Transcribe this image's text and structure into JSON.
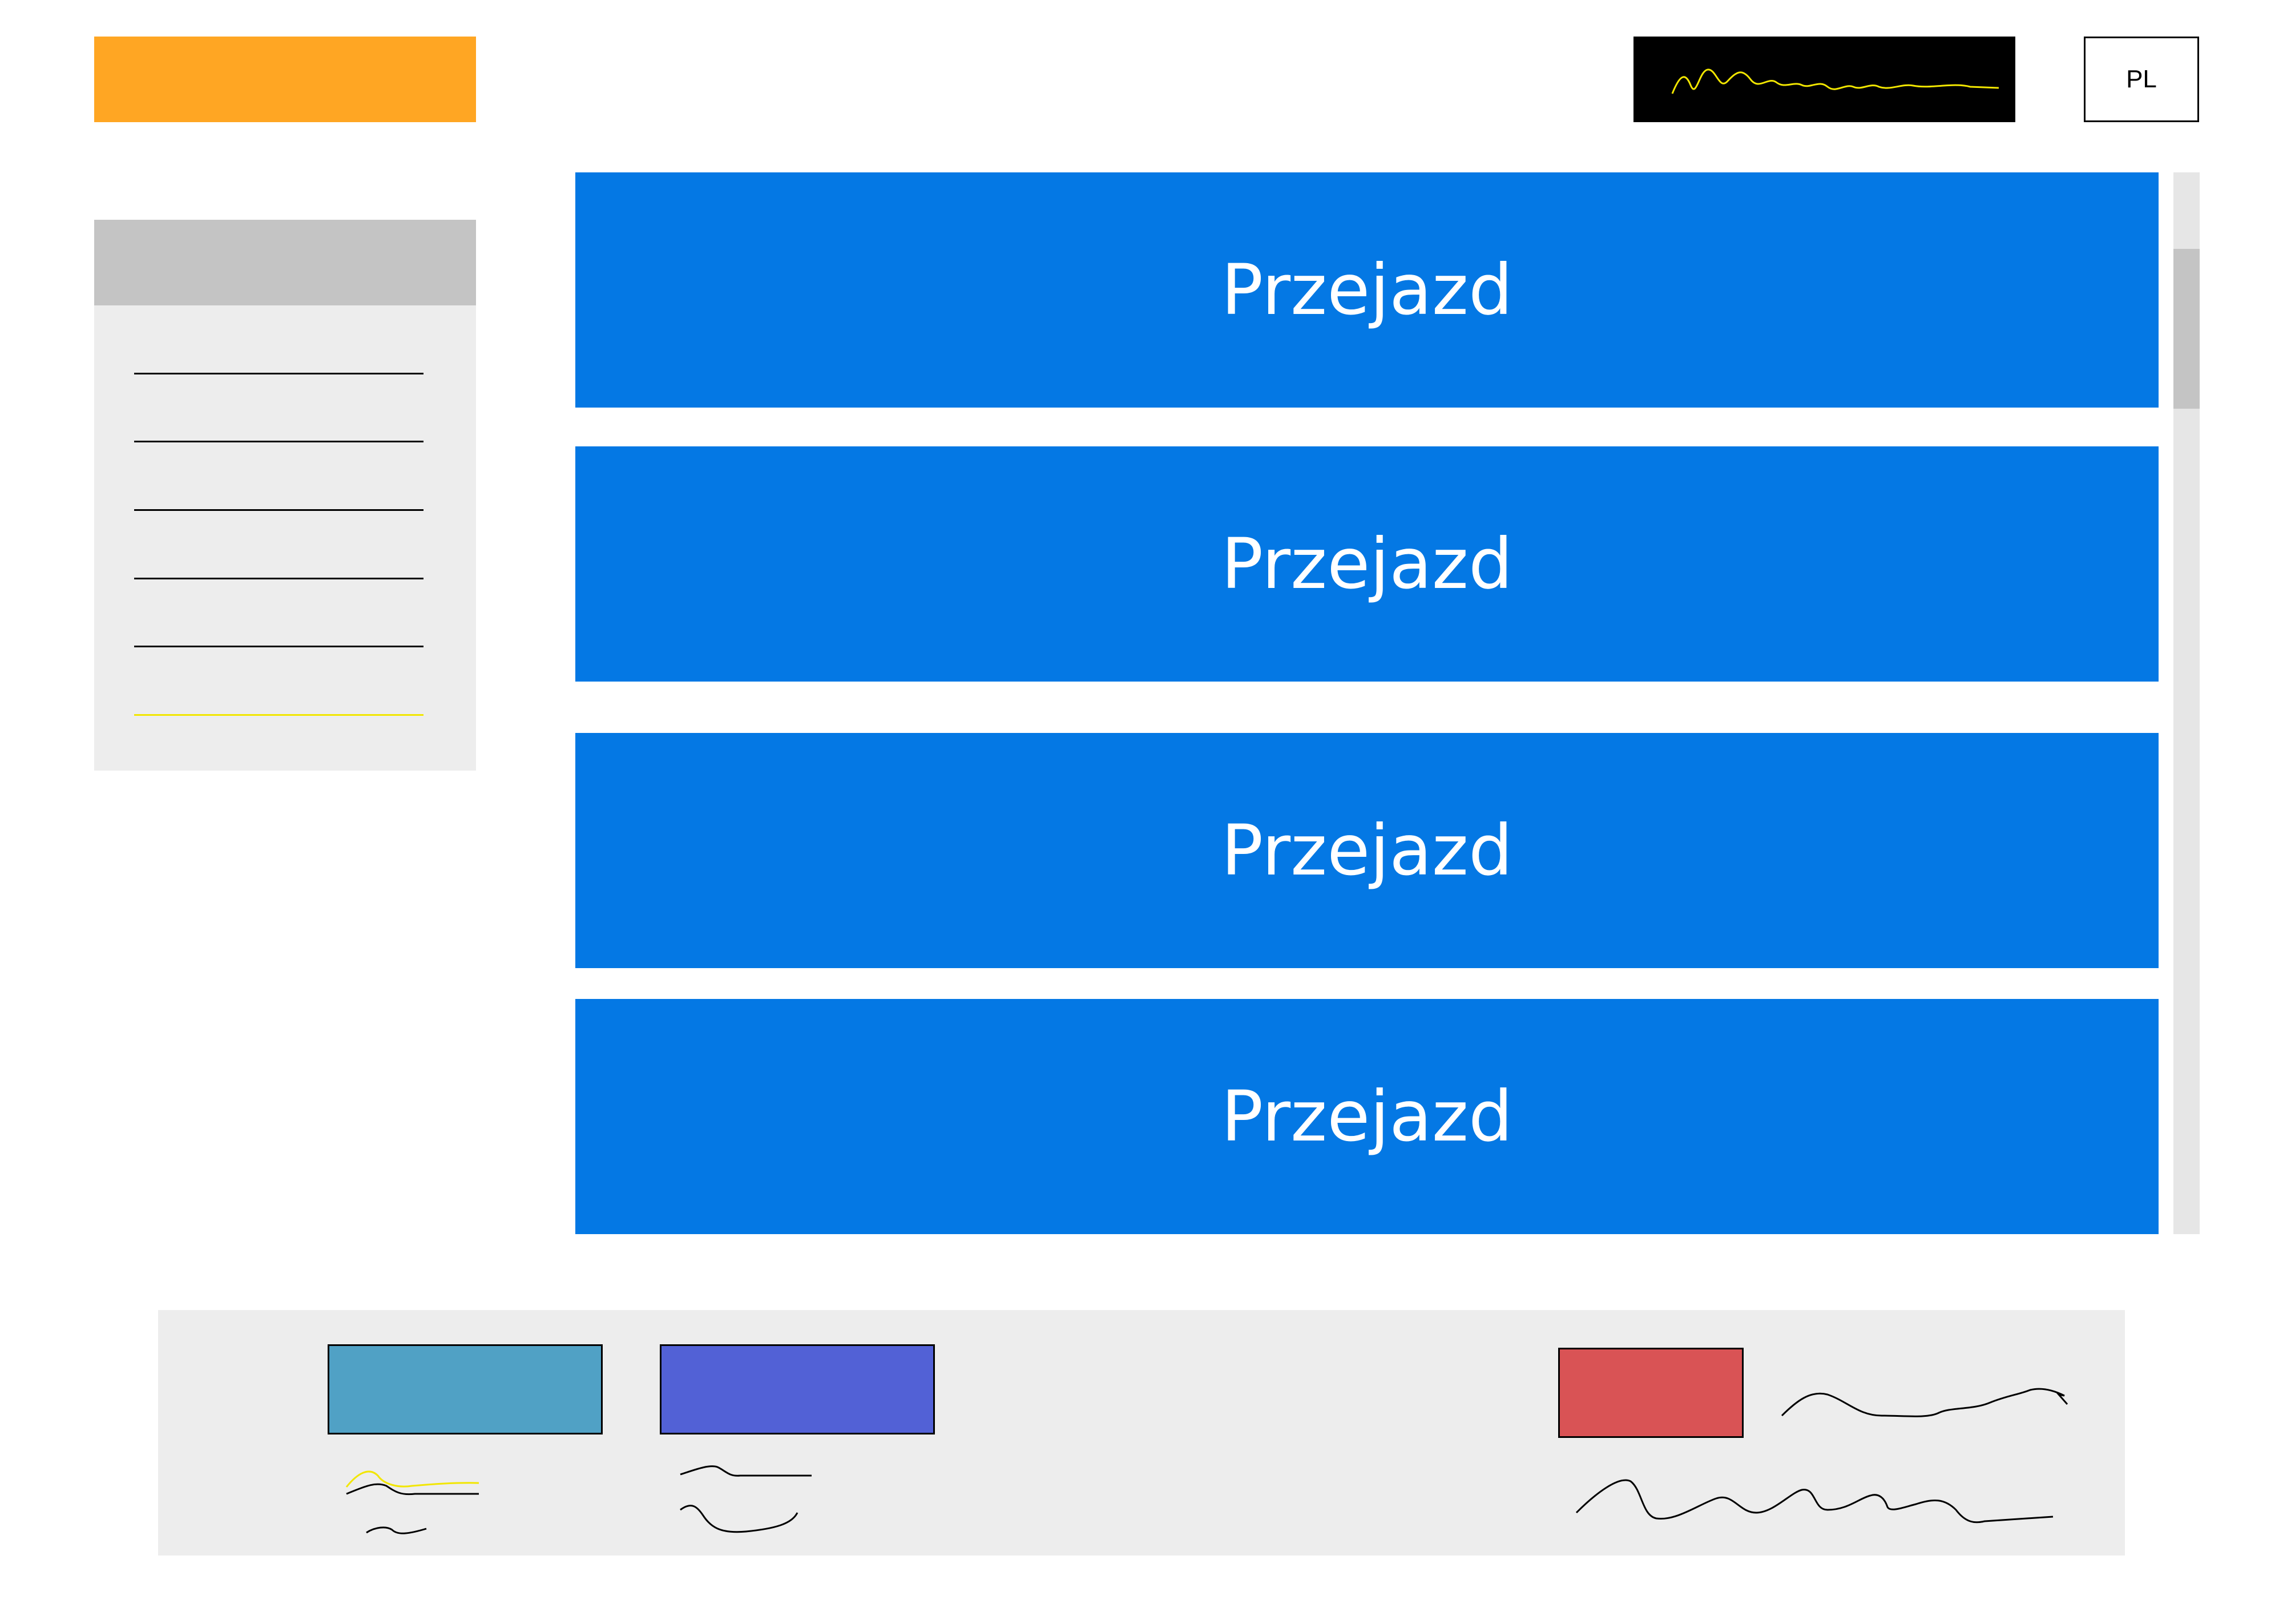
{
  "header": {
    "language": "PL"
  },
  "trips": [
    {
      "label": "Przejazd"
    },
    {
      "label": "Przejazd"
    },
    {
      "label": "Przejazd"
    },
    {
      "label": "Przejazd"
    }
  ],
  "colors": {
    "logo": "#ffa623",
    "trip_card": "#0478e4",
    "button_teal": "#50a1c5",
    "button_indigo": "#5261d6",
    "button_red": "#d95355",
    "highlight": "#f2e600"
  },
  "icons": {
    "signature": "handwritten-signature-scribble"
  }
}
